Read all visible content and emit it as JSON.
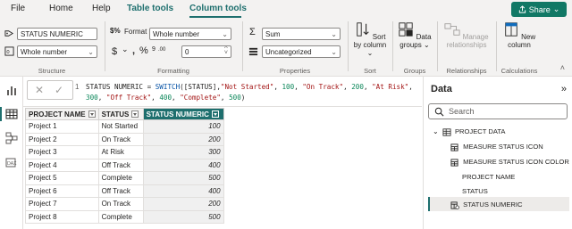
{
  "menu": {
    "items": [
      "File",
      "Home",
      "Help",
      "Table tools",
      "Column tools"
    ],
    "share_label": "Share"
  },
  "ribbon": {
    "structure": {
      "name_value": "STATUS NUMERIC",
      "data_type": "Whole number",
      "label": "Structure"
    },
    "formatting": {
      "format_label": "Format",
      "format_value": "Whole number",
      "decimal_value": "0",
      "symbols": [
        "$",
        ",",
        "%",
        "9"
      ],
      "label": "Formatting"
    },
    "properties": {
      "summarization": "Sum",
      "category": "Uncategorized",
      "label": "Properties"
    },
    "sort": {
      "button_label": "Sort by column",
      "label": "Sort"
    },
    "groups": {
      "button_label": "Data groups",
      "label": "Groups"
    },
    "relationships": {
      "button_label": "Manage relationships",
      "label": "Relationships"
    },
    "calculations": {
      "button_label": "New column",
      "label": "Calculations"
    }
  },
  "formula": {
    "line_number": "1",
    "text": "STATUS NUMERIC = SWITCH([STATUS],\"Not Started\", 100, \"On Track\", 200, \"At Risk\", 300, \"Off Track\", 400, \"Complete\", 500)"
  },
  "table": {
    "headers": [
      "PROJECT NAME",
      "STATUS",
      "STATUS NUMERIC"
    ],
    "rows": [
      [
        "Project 1",
        "Not Started",
        "100"
      ],
      [
        "Project 2",
        "On Track",
        "200"
      ],
      [
        "Project 3",
        "At Risk",
        "300"
      ],
      [
        "Project 4",
        "Off Track",
        "400"
      ],
      [
        "Project 5",
        "Complete",
        "500"
      ],
      [
        "Project 6",
        "Off Track",
        "400"
      ],
      [
        "Project 7",
        "On Track",
        "200"
      ],
      [
        "Project 8",
        "Complete",
        "500"
      ]
    ]
  },
  "data_pane": {
    "title": "Data",
    "search_placeholder": "Search",
    "table_name": "PROJECT DATA",
    "fields": [
      {
        "name": "MEASURE STATUS ICON",
        "icon": "calculator-icon"
      },
      {
        "name": "MEASURE STATUS ICON COLOR",
        "icon": "calculator-icon"
      },
      {
        "name": "PROJECT NAME",
        "icon": "none"
      },
      {
        "name": "STATUS",
        "icon": "none"
      },
      {
        "name": "STATUS NUMERIC",
        "icon": "calculated-column-icon"
      }
    ]
  },
  "colors": {
    "accent": "#1e6f6e",
    "share": "#117865",
    "selected_header": "#1e6f6e"
  }
}
